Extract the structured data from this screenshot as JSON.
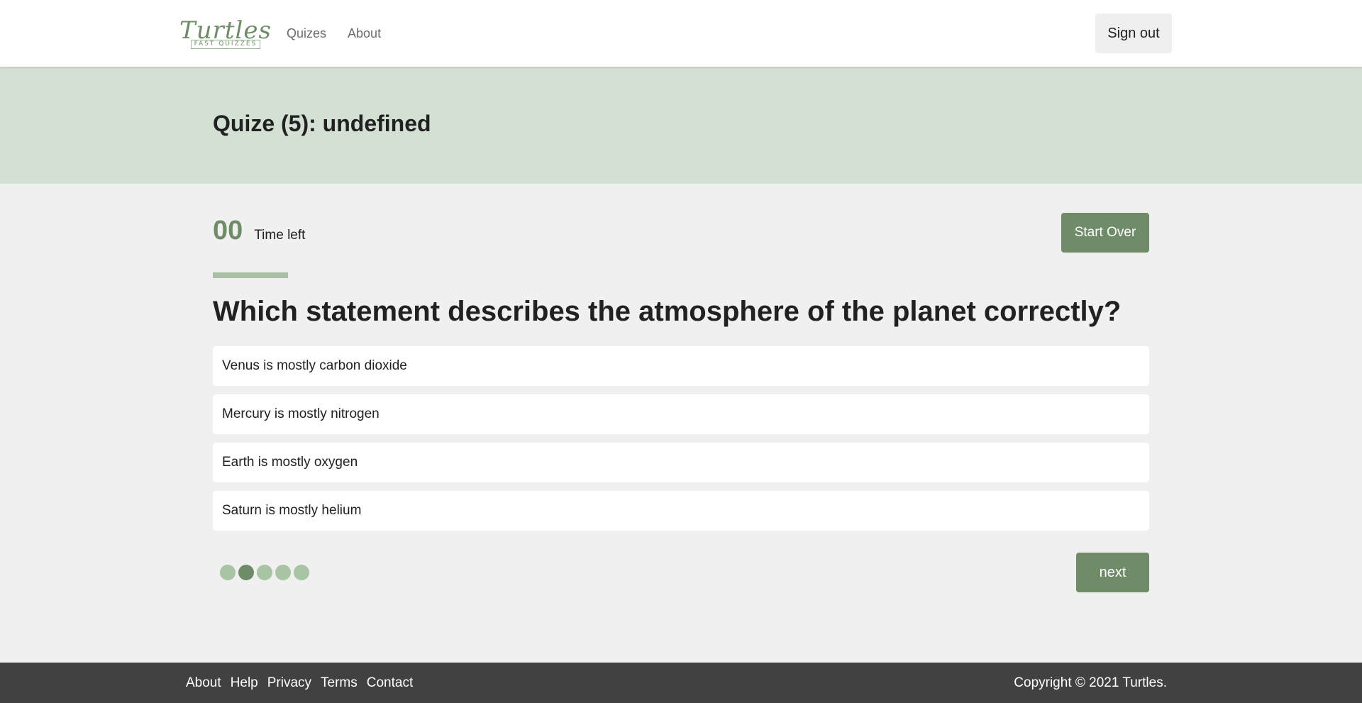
{
  "header": {
    "logo_main": "Turtles",
    "logo_sub": "FAST QUIZZES",
    "nav": [
      "Quizes",
      "About"
    ],
    "signout_label": "Sign out"
  },
  "banner": {
    "title": "Quize (5): undefined"
  },
  "quiz": {
    "timer_value": "00",
    "timer_label": "Time left",
    "start_over_label": "Start Over",
    "progress": 0.08,
    "question": "Which statement describes the atmosphere of the planet correctly?",
    "answers": [
      "Venus is mostly carbon dioxide",
      "Mercury is mostly nitrogen",
      "Earth is mostly oxygen",
      "Saturn is mostly helium"
    ],
    "total_questions": 5,
    "current_question": 2,
    "next_label": "next"
  },
  "footer": {
    "links": [
      "About",
      "Help",
      "Privacy",
      "Terms",
      "Contact"
    ],
    "copyright": "Copyright © 2021 Turtles."
  },
  "colors": {
    "accent": "#6f8b68",
    "accent_light": "#a9c4a4",
    "banner_bg": "#d3e0d4",
    "footer_bg": "#414141"
  }
}
